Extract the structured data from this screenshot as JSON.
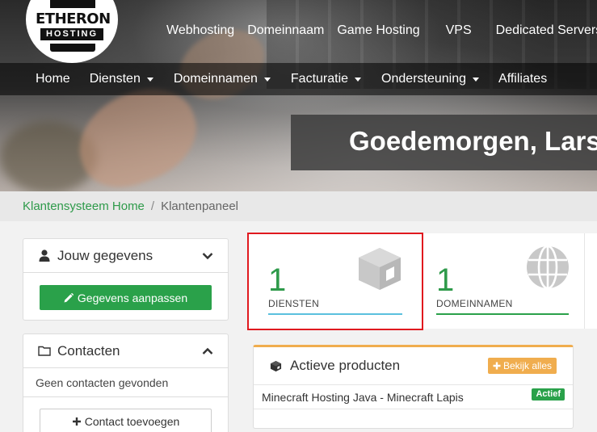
{
  "header": {
    "logo": {
      "top_text": "ETHERON",
      "bottom_text": "HOSTING"
    },
    "top_links": [
      "Webhosting",
      "Domeinnaam",
      "Game Hosting",
      "VPS",
      "Dedicated Servers"
    ],
    "main_nav": [
      {
        "label": "Home",
        "dropdown": false
      },
      {
        "label": "Diensten",
        "dropdown": true
      },
      {
        "label": "Domeinnamen",
        "dropdown": true
      },
      {
        "label": "Facturatie",
        "dropdown": true
      },
      {
        "label": "Ondersteuning",
        "dropdown": true
      },
      {
        "label": "Affiliates",
        "dropdown": false
      }
    ],
    "greeting": "Goedemorgen, Lars"
  },
  "breadcrumb": {
    "home": "Klantensysteem Home",
    "separator": "/",
    "current": "Klantenpaneel"
  },
  "sidebar": {
    "account": {
      "title": "Jouw gegevens",
      "edit_button": "Gegevens aanpassen",
      "icon": "user-icon"
    },
    "contacts": {
      "title": "Contacten",
      "empty_text": "Geen contacten gevonden",
      "add_button": "Contact toevoegen",
      "icon": "folder-icon"
    }
  },
  "stats": {
    "services": {
      "count": "1",
      "label": "DIENSTEN",
      "icon": "cube-icon",
      "color": "#5bc0de"
    },
    "domains": {
      "count": "1",
      "label": "DOMEINNAMEN",
      "icon": "globe-icon",
      "color": "#2aa14a"
    }
  },
  "products": {
    "title": "Actieve producten",
    "view_all": "Bekijk alles",
    "items": [
      {
        "name": "Minecraft Hosting Java - Minecraft Lapis",
        "status": "Actief"
      }
    ]
  },
  "colors": {
    "accent": "#2aa14a",
    "warning": "#f0ad4e",
    "highlight": "#e0191f"
  }
}
